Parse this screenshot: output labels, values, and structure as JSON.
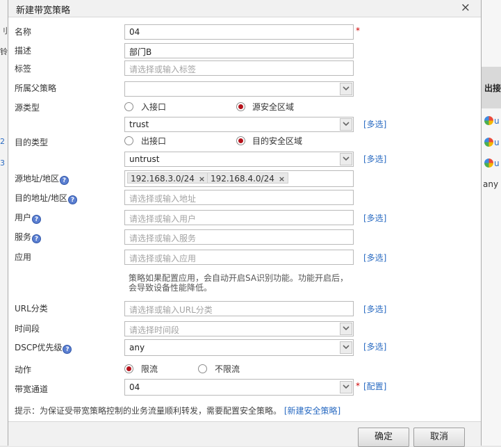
{
  "background": {
    "left_fragments": [
      "刂",
      "铃",
      "2",
      "3"
    ],
    "right_header": "出接",
    "right_rows": [
      "u",
      "u",
      "u"
    ],
    "right_any": "any"
  },
  "dialog": {
    "title": "新建带宽策略",
    "close": "×",
    "labels": {
      "name": "名称",
      "desc": "描述",
      "tag": "标签",
      "parent": "所属父策略",
      "src_type": "源类型",
      "dst_type": "目的类型",
      "src_addr": "源地址/地区",
      "dst_addr": "目的地址/地区",
      "user": "用户",
      "service": "服务",
      "app": "应用",
      "url": "URL分类",
      "time": "时间段",
      "dscp": "DSCP优先级",
      "action": "动作",
      "channel": "带宽通道"
    },
    "values": {
      "name": "04",
      "desc": "部门B",
      "src_zone": "trust",
      "dst_zone": "untrust",
      "src_addr_tags": [
        "192.168.3.0/24",
        "192.168.4.0/24"
      ],
      "dscp": "any",
      "channel": "04"
    },
    "placeholders": {
      "tag": "请选择或输入标签",
      "dst_addr": "请选择或输入地址",
      "user": "请选择或输入用户",
      "service": "请选择或输入服务",
      "app": "请选择或输入应用",
      "url": "请选择或输入URL分类",
      "time": "请选择时间段"
    },
    "options": {
      "src_iface": "入接口",
      "src_zone": "源安全区域",
      "dst_iface": "出接口",
      "dst_zone": "目的安全区域",
      "limit": "限流",
      "no_limit": "不限流"
    },
    "selected": {
      "src_type": "源安全区域",
      "dst_type": "目的安全区域",
      "action": "限流"
    },
    "links": {
      "multi": "[多选]",
      "config": "[配置]",
      "new_security_policy": "[新建安全策略]"
    },
    "required_mark": "*",
    "tag_remove": "×",
    "help_icon": "?",
    "app_note": "策略如果配置应用，会自动开启SA识别功能。功能开启后，会导致设备性能降低。",
    "tip": "提示：为保证受带宽策略控制的业务流量顺利转发，需要配置安全策略。",
    "buttons": {
      "ok": "确定",
      "cancel": "取消"
    }
  },
  "colors": {
    "accent_link": "#2a6bc2",
    "radio_selected": "#b5121b",
    "required": "#cc0000"
  }
}
